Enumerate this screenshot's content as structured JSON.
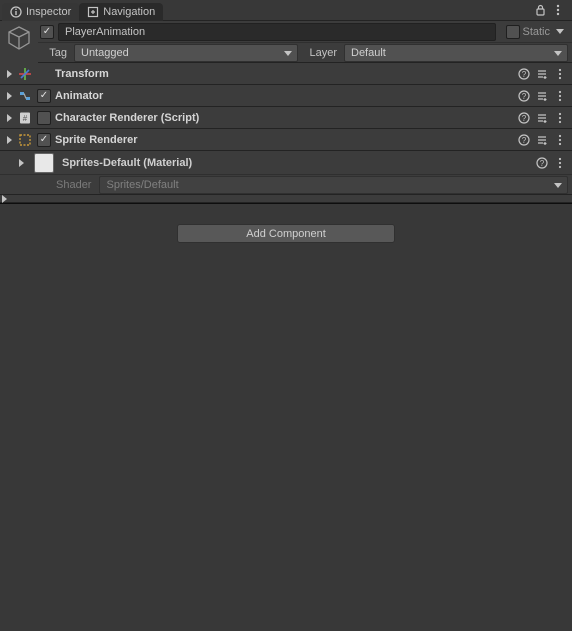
{
  "tabs": {
    "inspector": "Inspector",
    "navigation": "Navigation"
  },
  "header": {
    "active_checked": true,
    "name": "PlayerAnimation",
    "static_label": "Static"
  },
  "tagRow": {
    "tag_label": "Tag",
    "tag_value": "Untagged",
    "layer_label": "Layer",
    "layer_value": "Default"
  },
  "components": [
    {
      "title": "Transform",
      "has_checkbox": false,
      "checked": false,
      "icon": "transform"
    },
    {
      "title": "Animator",
      "has_checkbox": true,
      "checked": true,
      "icon": "animator"
    },
    {
      "title": "Character Renderer (Script)",
      "has_checkbox": true,
      "checked": false,
      "icon": "script"
    },
    {
      "title": "Sprite Renderer",
      "has_checkbox": true,
      "checked": true,
      "icon": "sprite"
    }
  ],
  "material": {
    "name": "Sprites-Default (Material)",
    "shader_label": "Shader",
    "shader_value": "Sprites/Default"
  },
  "add_button": "Add Component"
}
